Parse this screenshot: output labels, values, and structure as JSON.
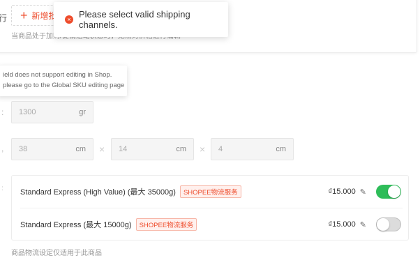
{
  "variations": {
    "add_button_label": "新增批",
    "left_cut_text": "行",
    "helper_text": "当商品处于加购/促销活动状态时，无法对价格进行编辑"
  },
  "toast": {
    "icon": "error-circle-icon",
    "message": "Please select valid shipping channels."
  },
  "tooltip": {
    "line1": "ield does not support editing in Shop.",
    "line2": "please go to the Global SKU editing page"
  },
  "weight": {
    "value": "1300",
    "unit": "gr"
  },
  "dimensions": {
    "length": {
      "value": "38",
      "unit": "cm"
    },
    "width": {
      "value": "14",
      "unit": "cm"
    },
    "height": {
      "value": "4",
      "unit": "cm"
    },
    "separator": "×"
  },
  "shipping": {
    "channels": [
      {
        "name": "Standard Express (High Value)  (最大 35000g)",
        "badge": "SHOPEE物流服务",
        "fee": "₫15.000",
        "enabled": true
      },
      {
        "name": "Standard Express  (最大 15000g)",
        "badge": "SHOPEE物流服务",
        "fee": "₫15.000",
        "enabled": false
      }
    ],
    "footer_note": "商品物流设定仅适用于此商品"
  },
  "colors": {
    "accent": "#ee4d2d",
    "toggle_on": "#2ebd59",
    "toggle_off": "#dcdcdc"
  }
}
